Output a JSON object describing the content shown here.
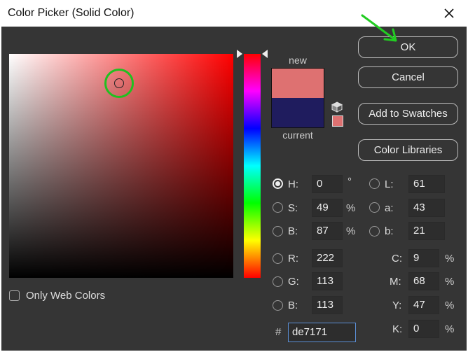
{
  "window": {
    "title": "Color Picker (Solid Color)"
  },
  "labels": {
    "new": "new",
    "current": "current",
    "only_web_colors": "Only Web Colors",
    "hash": "#"
  },
  "buttons": {
    "ok": "OK",
    "cancel": "Cancel",
    "add_to_swatches": "Add to Swatches",
    "color_libraries": "Color Libraries"
  },
  "fields": {
    "H": {
      "label": "H:",
      "value": "0",
      "unit": "°",
      "selected": true
    },
    "S": {
      "label": "S:",
      "value": "49",
      "unit": "%"
    },
    "Bv": {
      "label": "B:",
      "value": "87",
      "unit": "%"
    },
    "R": {
      "label": "R:",
      "value": "222"
    },
    "G": {
      "label": "G:",
      "value": "113"
    },
    "Bc": {
      "label": "B:",
      "value": "113"
    },
    "L": {
      "label": "L:",
      "value": "61"
    },
    "a": {
      "label": "a:",
      "value": "43"
    },
    "b": {
      "label": "b:",
      "value": "21"
    },
    "C": {
      "label": "C:",
      "value": "9",
      "unit": "%"
    },
    "M": {
      "label": "M:",
      "value": "68",
      "unit": "%"
    },
    "Y": {
      "label": "Y:",
      "value": "47",
      "unit": "%"
    },
    "K": {
      "label": "K:",
      "value": "0",
      "unit": "%"
    }
  },
  "hex": {
    "value": "de7171"
  },
  "colors": {
    "new": "#de7171",
    "current": "#1f1c5e",
    "dialog_bg": "#353535",
    "highlight": "#20c020"
  },
  "icons": {
    "close": "close-icon",
    "cube": "cube-icon",
    "arrow": "annotation-arrow-icon"
  }
}
